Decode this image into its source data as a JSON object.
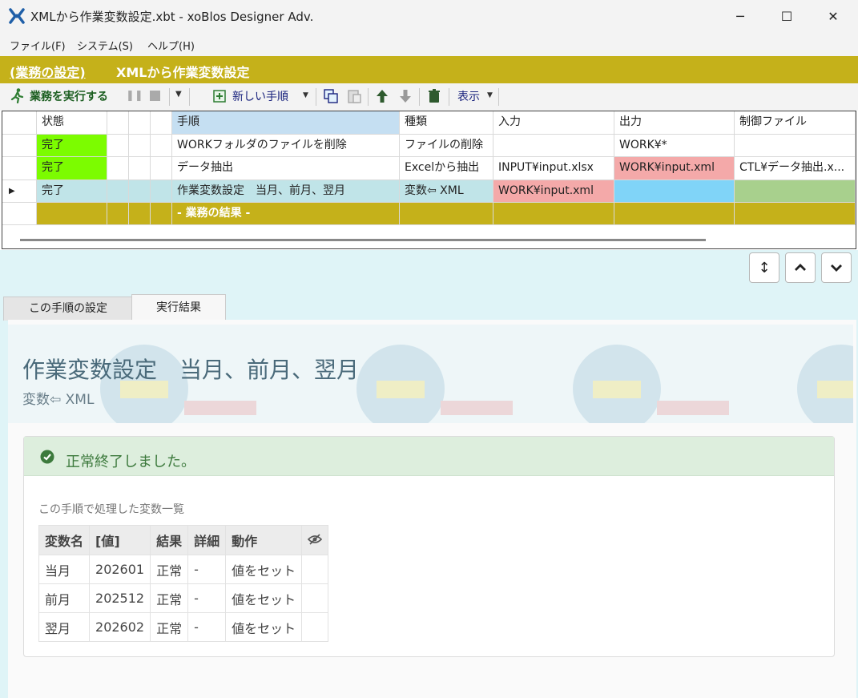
{
  "window": {
    "title": "XMLから作業変数設定.xbt - xoBlos Designer Adv."
  },
  "menu": {
    "items": [
      "ファイル(F)",
      "システム(S)",
      "ヘルプ(H)"
    ]
  },
  "header": {
    "link": "(業務の設定)",
    "title": "XMLから作業変数設定"
  },
  "toolbar": {
    "run_label": "業務を実行する",
    "new_step_label": "新しい手順",
    "view_label": "表示"
  },
  "grid": {
    "columns": [
      "状態",
      "手順",
      "種類",
      "入力",
      "出力",
      "制御ファイル"
    ],
    "rows": [
      {
        "status": "完了",
        "step": "WORKフォルダのファイルを削除",
        "type": "ファイルの削除",
        "input": "",
        "output": "WORK¥*",
        "control": ""
      },
      {
        "status": "完了",
        "step": "データ抽出",
        "type": "Excelから抽出",
        "input": "INPUT¥input.xlsx",
        "output": "WORK¥input.xml",
        "control": "CTL¥データ抽出.x..."
      },
      {
        "status": "完了",
        "step": "作業変数設定　当月、前月、翌月",
        "type": "変数⇦ XML",
        "input": "WORK¥input.xml",
        "output": "",
        "control": ""
      }
    ],
    "result_row": "- 業務の結果 -"
  },
  "tabs": {
    "settings": "この手順の設定",
    "result": "実行結果"
  },
  "step": {
    "title": "作業変数設定　当月、前月、翌月",
    "subtitle": "変数⇦ XML"
  },
  "result": {
    "message": "正常終了しました。",
    "caption": "この手順で処理した変数一覧",
    "headers": [
      "変数名",
      "[値]",
      "結果",
      "詳細",
      "動作"
    ],
    "rows": [
      {
        "name": "当月",
        "value": "202601",
        "result": "正常",
        "detail": "-",
        "action": "値をセット"
      },
      {
        "name": "前月",
        "value": "202512",
        "result": "正常",
        "detail": "-",
        "action": "値をセット"
      },
      {
        "name": "翌月",
        "value": "202602",
        "result": "正常",
        "detail": "-",
        "action": "値をセット"
      }
    ]
  },
  "colors": {
    "gold": "#c5b11a",
    "status_green": "#7cfc00",
    "output_red": "#f4a9a9",
    "selected_row": "#c0e4e8",
    "output_blue": "#80d4f8",
    "control_green": "#a8d08d",
    "success_bg": "#ddeedd"
  }
}
